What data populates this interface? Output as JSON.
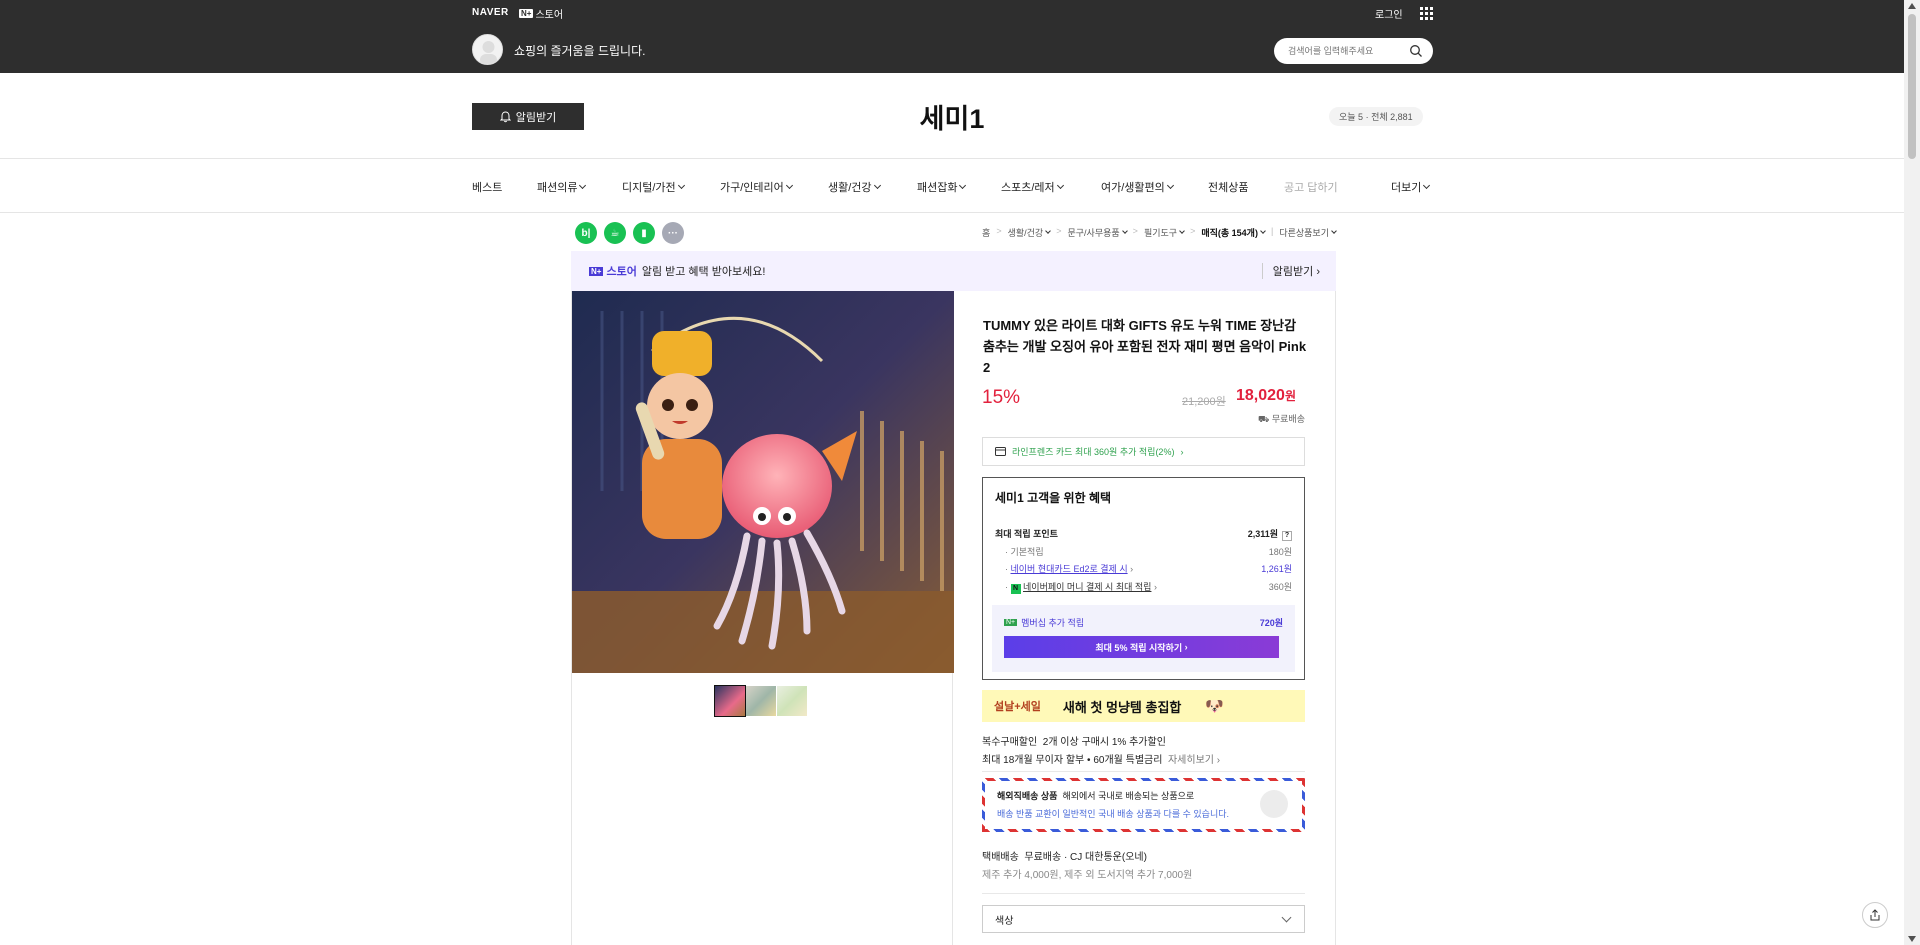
{
  "topbar": {
    "brand": "NAVER",
    "nstore_icon": "N+",
    "nstore_label": "스토어",
    "login": "로그인",
    "slogan": "쇼핑의 즐거움을 드립니다.",
    "search_placeholder": "검색어를 입력해주세요"
  },
  "store": {
    "alarm_button": "알림받기",
    "name": "세미1",
    "visit_stats": "오늘 5 · 전체 2,881"
  },
  "categories": [
    {
      "label": "베스트",
      "chevron": false,
      "muted": false
    },
    {
      "label": "패션의류",
      "chevron": true,
      "muted": false
    },
    {
      "label": "디지털/가전",
      "chevron": true,
      "muted": false
    },
    {
      "label": "가구/인테리어",
      "chevron": true,
      "muted": false
    },
    {
      "label": "생활/건강",
      "chevron": true,
      "muted": false
    },
    {
      "label": "패션잡화",
      "chevron": true,
      "muted": false
    },
    {
      "label": "스포츠/레저",
      "chevron": true,
      "muted": false
    },
    {
      "label": "여가/생활편의",
      "chevron": true,
      "muted": false
    },
    {
      "label": "전체상품",
      "chevron": false,
      "muted": false
    },
    {
      "label": "공고 답하기",
      "chevron": false,
      "muted": true
    },
    {
      "label": "더보기",
      "chevron": true,
      "muted": false
    }
  ],
  "share_icons": [
    {
      "name": "blog-share-icon",
      "glyph": "b|",
      "color": "#19c153"
    },
    {
      "name": "cafe-share-icon",
      "glyph": "☕",
      "color": "#19c153"
    },
    {
      "name": "bookmark-share-icon",
      "glyph": "▮",
      "color": "#19c153"
    },
    {
      "name": "more-share-icon",
      "glyph": "···",
      "color": "#a6a9b5"
    }
  ],
  "breadcrumb": {
    "home": "홈",
    "c1": "생활/건강",
    "c2": "문구/사무용품",
    "c3": "필기도구",
    "current": "매직(총 154개)",
    "other": "다른상품보기"
  },
  "banner": {
    "nstore_icon": "N+",
    "nstore_label": "스토어",
    "message": "알림 받고 혜택 받아보세요!",
    "action": "알림받기"
  },
  "product": {
    "title": "TUMMY 있은 라이트 대화 GIFTS 유도 누워 TIME 장난감 춤추는 개발 오징어 유아 포함된 전자 재미 평면 음악이 Pink 2",
    "discount": "15%",
    "original_price": "21,200원",
    "price": "18,020",
    "price_unit": "원",
    "shipping": "무료배송",
    "card_benefit": "라인프렌즈 카드 최대 360원 추가 적립(2%)"
  },
  "benefit": {
    "title": "세미1 고객을 위한 혜택",
    "max_point_label": "최대 적립 포인트",
    "max_point_value": "2,311원",
    "basic_label": "기본적립",
    "basic_value": "180원",
    "card_label": "네이버 현대카드 Ed2로 결제 시",
    "card_value": "1,261원",
    "pay_label": "네이버페이 머니 결제 시 최대 적립",
    "pay_value": "360원",
    "membership_label": "멤버십 추가 적립",
    "membership_value": "720원",
    "membership_button": "최대 5% 적립 시작하기"
  },
  "promo": {
    "tag": "설날+세일",
    "text": "새해 첫 멍냥템 총집합",
    "emoji": "🐶"
  },
  "multi_discount": {
    "label": "복수구매할인",
    "text": "2개 이상 구매시 1% 추가할인",
    "installment": "최대 18개월 무이자 할부 • 60개월 특별금리",
    "detail": "자세히보기"
  },
  "overseas": {
    "title": "해외직배송 상품",
    "desc": "해외에서 국내로 배송되는 상품으로",
    "note": "배송 반품 교환이 일반적인 국내 배송 상품과 다를 수 있습니다."
  },
  "delivery": {
    "label": "택배배송",
    "text": "무료배송 · CJ 대한통운(오네)",
    "extra": "제주 추가 4,000원, 제주 외 도서지역 추가 7,000원"
  },
  "option": {
    "placeholder": "색상"
  }
}
